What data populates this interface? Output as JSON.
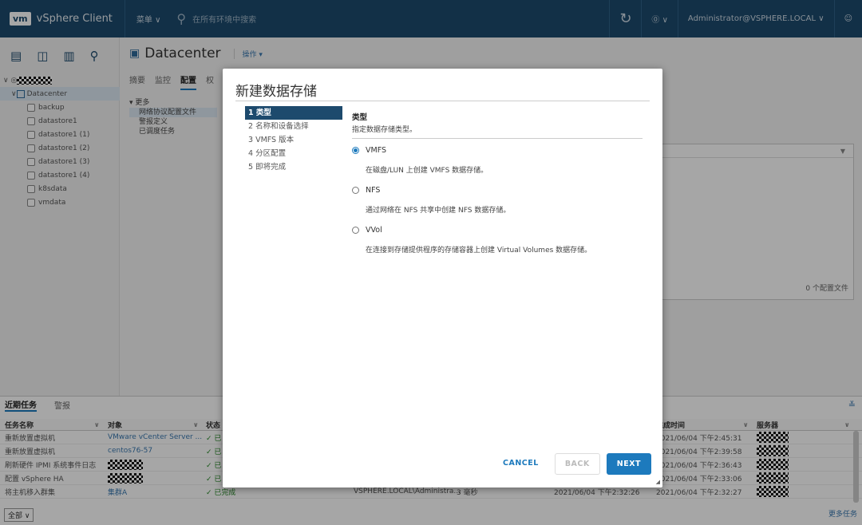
{
  "topbar": {
    "logo": "vm",
    "app_name": "vSphere Client",
    "menu_label": "菜单 ∨",
    "search_placeholder": "在所有环境中搜索",
    "help_label": "⓪ ∨",
    "user": "Administrator@VSPHERE.LOCAL ∨"
  },
  "nav": {
    "tree": [
      {
        "label": "Datacenter"
      },
      {
        "label": "backup"
      },
      {
        "label": "datastore1"
      },
      {
        "label": "datastore1 (1)"
      },
      {
        "label": "datastore1 (2)"
      },
      {
        "label": "datastore1 (3)"
      },
      {
        "label": "datastore1 (4)"
      },
      {
        "label": "k8sdata"
      },
      {
        "label": "vmdata"
      }
    ]
  },
  "content": {
    "title": "Datacenter",
    "actions": "操作 ▾",
    "tabs": [
      "摘要",
      "监控",
      "配置",
      "权"
    ],
    "config_items": [
      "▾ 更多",
      "网络协议配置文件",
      "警报定义",
      "已调度任务"
    ],
    "right_count": "0 个配置文件"
  },
  "bottom": {
    "tabs": [
      "近期任务",
      "警报"
    ],
    "headers": {
      "task": "任务名称",
      "object": "对象",
      "status": "状态",
      "completed": "完成时间",
      "server": "服务器"
    },
    "rows": [
      {
        "task": "重新放置虚拟机",
        "object": "VMware vCenter Server ...",
        "status": "✓ 已",
        "completed": "2021/06/04 下午2:45:31"
      },
      {
        "task": "重新放置虚拟机",
        "object": "centos76-57",
        "status": "✓ 已",
        "completed": "2021/06/04 下午2:39:58"
      },
      {
        "task": "刷新硬件 IPMI 系统事件日志",
        "object": "",
        "status": "✓ 已",
        "completed": "2021/06/04 下午2:36:43"
      },
      {
        "task": "配置 vSphere HA",
        "object": "",
        "status": "✓ 已",
        "completed": "2021/06/04 下午2:33:06"
      },
      {
        "task": "将主机移入群集",
        "object": "集群A",
        "status": "✓ 已完成",
        "initiator": "VSPHERE.LOCAL\\Administra...",
        "queued": "3 毫秒",
        "start": "2021/06/04 下午2:32:26",
        "completed": "2021/06/04 下午2:32:27"
      }
    ],
    "filter": "全部",
    "more": "更多任务"
  },
  "dialog": {
    "title": "新建数据存储",
    "steps": [
      "1 类型",
      "2 名称和设备选择",
      "3 VMFS 版本",
      "4 分区配置",
      "5 即将完成"
    ],
    "heading": "类型",
    "subheading": "指定数据存储类型。",
    "options": [
      {
        "label": "VMFS",
        "desc": "在磁盘/LUN 上创建 VMFS 数据存储。",
        "selected": true
      },
      {
        "label": "NFS",
        "desc": "通过网络在 NFS 共享中创建 NFS 数据存储。",
        "selected": false
      },
      {
        "label": "VVol",
        "desc": "在连接到存储提供程序的存储容器上创建 Virtual Volumes 数据存储。",
        "selected": false
      }
    ],
    "cancel": "CANCEL",
    "back": "BACK",
    "next": "NEXT"
  }
}
